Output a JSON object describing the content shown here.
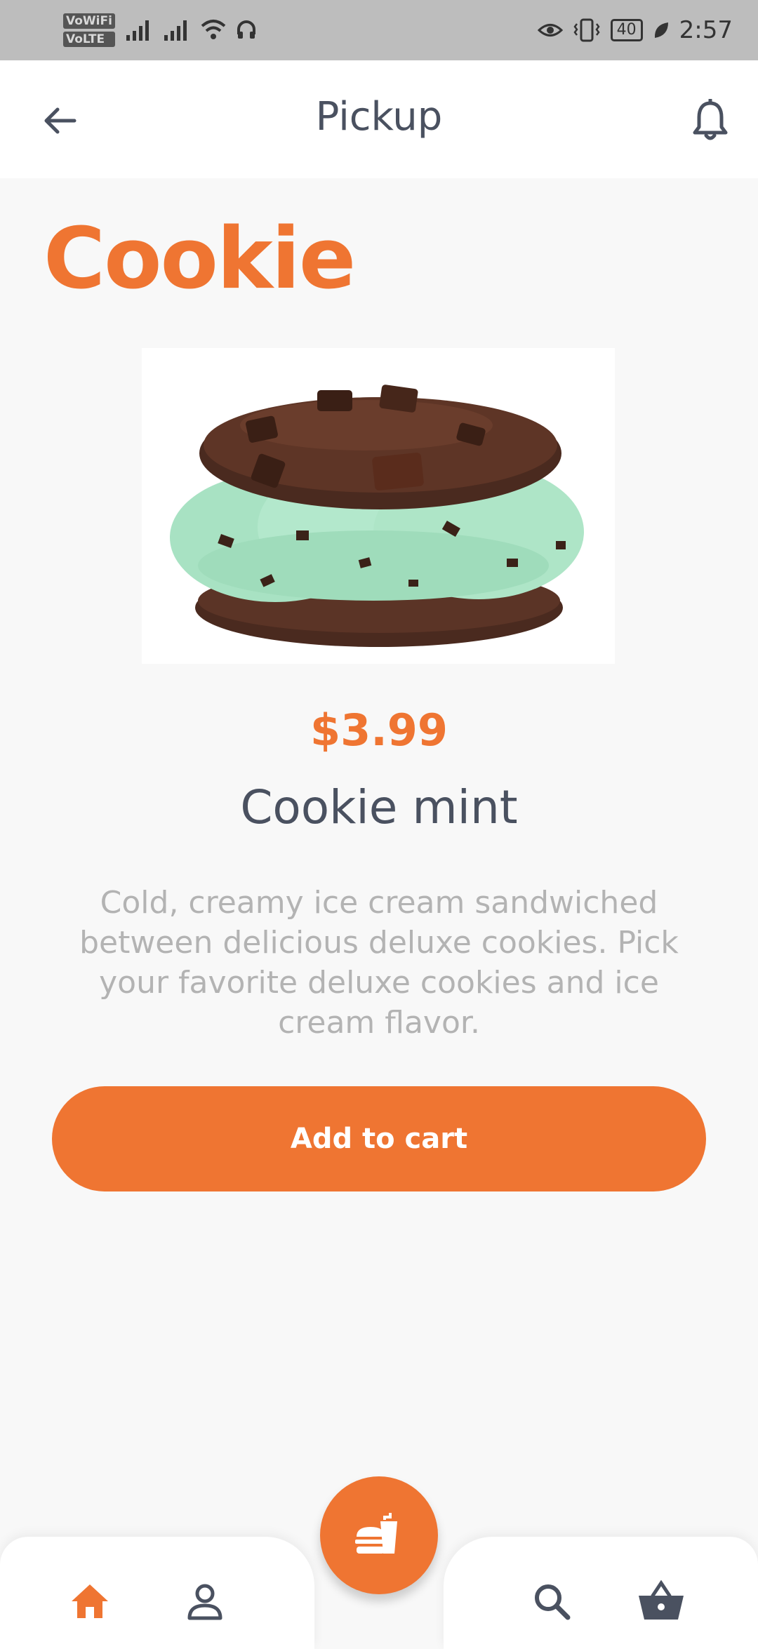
{
  "status_bar": {
    "sim1_tag": "VoWiFi",
    "sim2_tag": "VoLTE",
    "battery": "40",
    "time": "2:57"
  },
  "header": {
    "title": "Pickup",
    "back_icon": "arrow-left-icon",
    "notification_icon": "bell-icon"
  },
  "product": {
    "category": "Cookie",
    "price": "$3.99",
    "name": "Cookie mint",
    "description": "Cold, creamy ice cream sandwiched between delicious deluxe cookies. Pick your favorite deluxe cookies and ice cream flavor.",
    "add_to_cart_label": "Add to cart"
  },
  "bottom_nav": {
    "items": [
      "home-icon",
      "profile-icon",
      "menu-food-icon",
      "search-icon",
      "basket-icon"
    ],
    "active": "home-icon"
  },
  "colors": {
    "accent": "#ef7532",
    "text_dark": "#4a5160",
    "text_muted": "#b3b3b3",
    "inactive_icon": "#4a5160"
  }
}
